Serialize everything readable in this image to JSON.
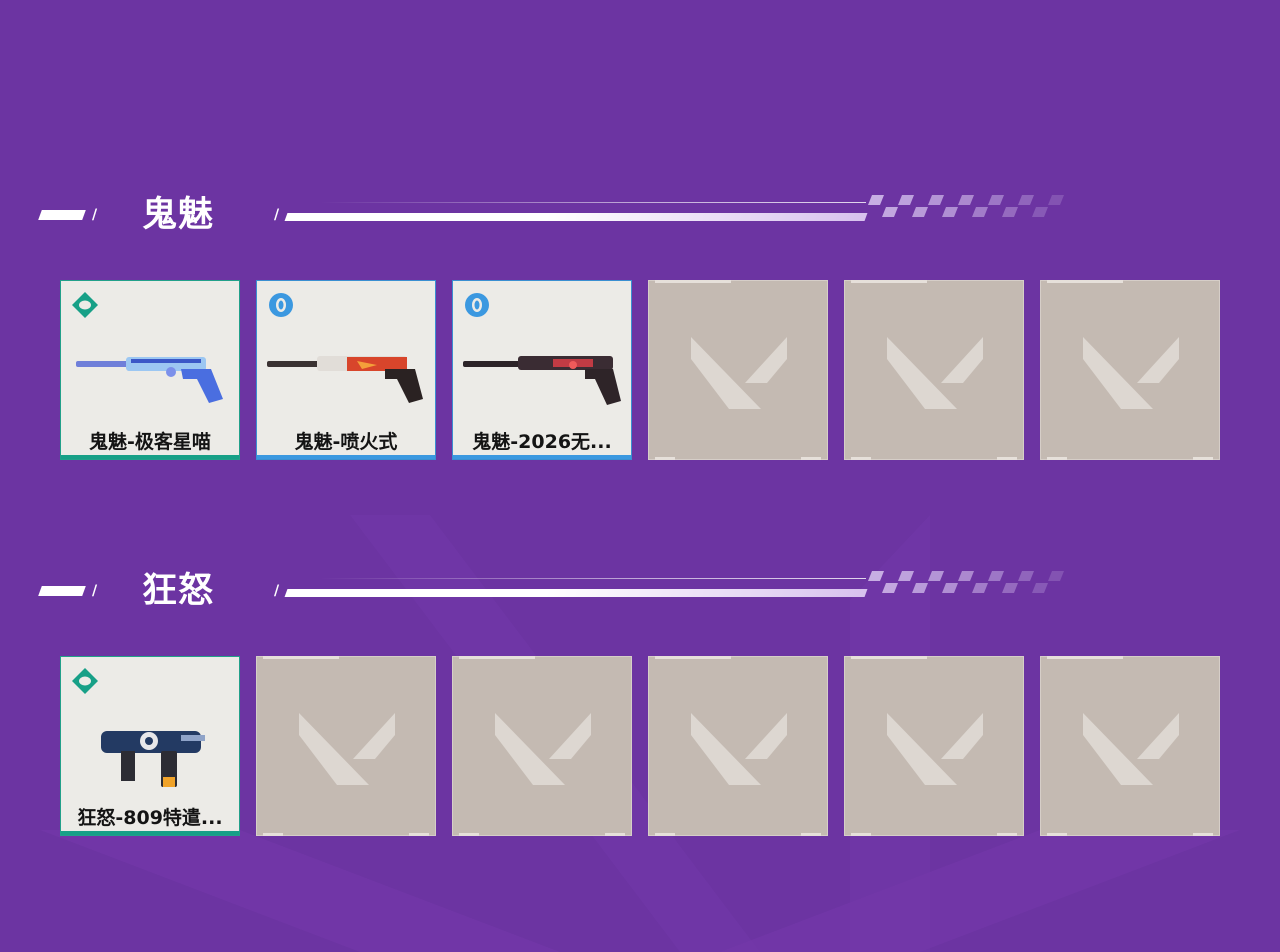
{
  "sections": [
    {
      "title": "鬼魅",
      "slash": "/",
      "items": [
        {
          "label": "鬼魅-极客星喵",
          "tier_icon": "tier-premium-icon",
          "tier_color": "#17a087"
        },
        {
          "label": "鬼魅-喷火式",
          "tier_icon": "tier-select-icon",
          "tier_color": "#3b98e0"
        },
        {
          "label": "鬼魅-2026无...",
          "tier_icon": "tier-select-icon",
          "tier_color": "#3b98e0"
        }
      ],
      "empty_slots": 3
    },
    {
      "title": "狂怒",
      "slash": "/",
      "items": [
        {
          "label": "狂怒-809特遣...",
          "tier_icon": "tier-premium-icon",
          "tier_color": "#17a087"
        }
      ],
      "empty_slots": 5
    }
  ],
  "colors": {
    "background": "#6c34a2",
    "card_filled": "#ecebe7",
    "card_empty": "#c4bab2",
    "premium": "#17a087",
    "select": "#3b98e0"
  }
}
